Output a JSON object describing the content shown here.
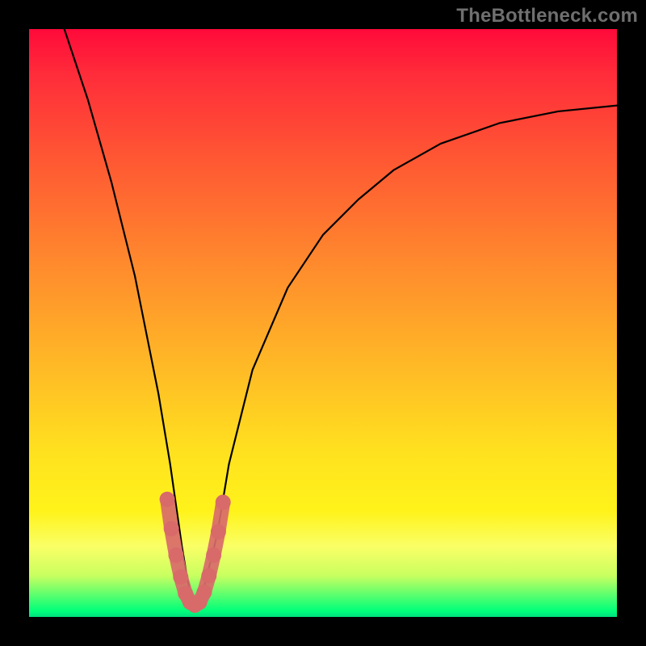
{
  "attribution": "TheBottleneck.com",
  "chart_data": {
    "type": "line",
    "title": "",
    "xlabel": "",
    "ylabel": "",
    "xlim": [
      0,
      100
    ],
    "ylim": [
      0,
      100
    ],
    "background": "red-yellow-green vertical gradient",
    "series": [
      {
        "name": "bottleneck-curve",
        "stroke": "#000000",
        "x": [
          6,
          10,
          14,
          18,
          20,
          22,
          24,
          26,
          27,
          28,
          29,
          30,
          32,
          34,
          38,
          44,
          50,
          56,
          62,
          70,
          80,
          90,
          100
        ],
        "y": [
          100,
          88,
          74,
          58,
          48,
          38,
          26,
          12,
          6,
          2,
          2,
          6,
          14,
          26,
          42,
          56,
          65,
          71,
          76,
          80.5,
          84,
          86,
          87
        ]
      },
      {
        "name": "highlight-dots",
        "stroke": "#d86a6a",
        "marker": "circle",
        "x": [
          23.5,
          24.2,
          25.0,
          25.8,
          26.6,
          27.4,
          28.2,
          29.0,
          29.8,
          30.6,
          31.4,
          32.2,
          33.0
        ],
        "y": [
          20.0,
          15.0,
          10.5,
          6.8,
          4.0,
          2.5,
          2.0,
          2.5,
          4.2,
          7.0,
          10.5,
          14.5,
          19.5
        ]
      }
    ]
  }
}
